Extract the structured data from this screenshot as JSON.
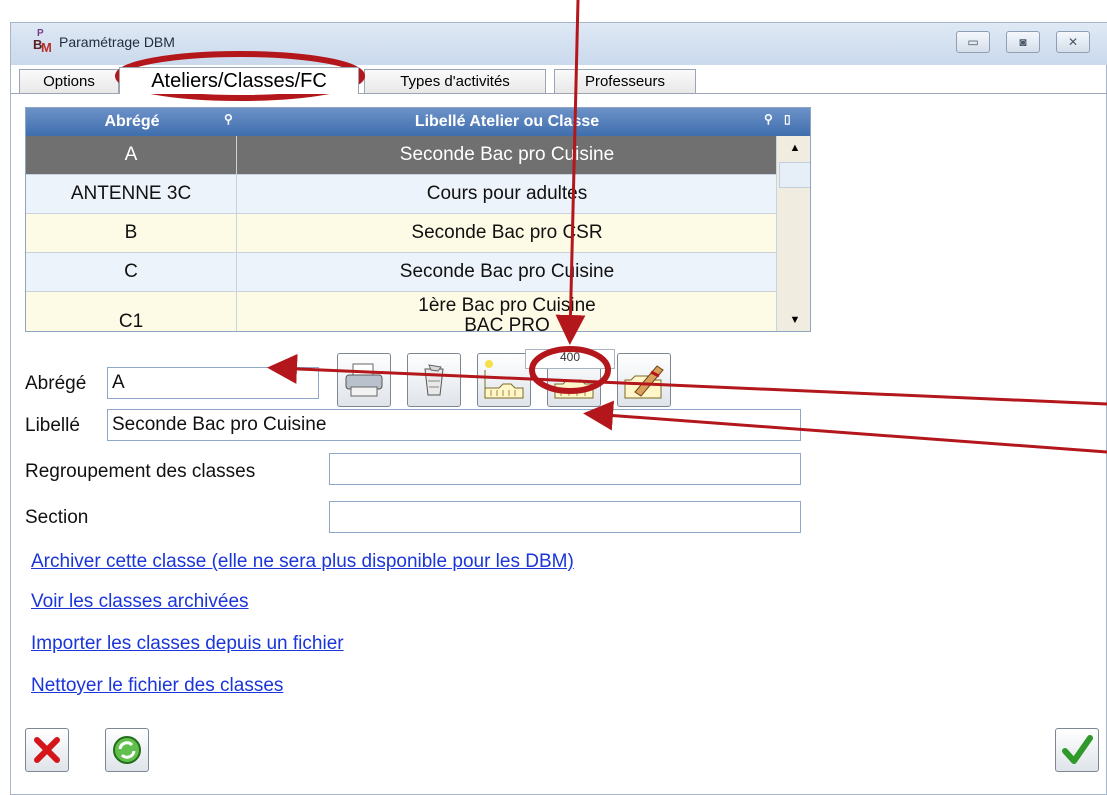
{
  "window": {
    "title": "Paramétrage DBM",
    "icon": "dbm-app-icon",
    "icon_text_top": "P",
    "icon_text_b": "B",
    "icon_text_m": "M",
    "buttons": [
      "minimize",
      "maximize",
      "close"
    ]
  },
  "tabs": [
    {
      "label": "Options",
      "active": false
    },
    {
      "label": "Ateliers/Classes/FC",
      "active": true
    },
    {
      "label": "Types d'activités",
      "active": false
    },
    {
      "label": "Professeurs",
      "active": false
    }
  ],
  "table": {
    "columns": [
      "Abrégé",
      "Libellé Atelier ou Classe"
    ],
    "rows": [
      {
        "abrege": "A",
        "libelle": "Seconde Bac pro Cuisine",
        "selected": true
      },
      {
        "abrege": "ANTENNE 3C",
        "libelle": "Cours pour adultes"
      },
      {
        "abrege": "B",
        "libelle": "Seconde Bac pro CSR"
      },
      {
        "abrege": "C",
        "libelle": "Seconde Bac pro Cuisine"
      },
      {
        "abrege": "C1",
        "libelle": "1ère Bac pro Cuisine",
        "libelle_line2": "BAC PRO"
      }
    ]
  },
  "tooltip": "400",
  "toolbar": [
    {
      "name": "print-icon"
    },
    {
      "name": "delete-icon"
    },
    {
      "name": "new-record-icon"
    },
    {
      "name": "highlighted-record-icon"
    },
    {
      "name": "edit-record-icon"
    }
  ],
  "form": {
    "abrege_label": "Abrégé",
    "abrege_value": "A",
    "libelle_label": "Libellé",
    "libelle_value": "Seconde Bac pro Cuisine",
    "regroupement_label": "Regroupement des classes",
    "regroupement_value": "",
    "section_label": "Section",
    "section_value": ""
  },
  "links": [
    "Archiver cette classe (elle ne sera plus disponible pour les DBM)",
    "Voir les classes archivées",
    "Importer les classes depuis un fichier",
    "Nettoyer le fichier des classes"
  ],
  "bottom_buttons": [
    "cancel-icon",
    "refresh-icon",
    "validate-icon"
  ],
  "colors": {
    "annotation": "#b3171b",
    "header": "#4a77b4",
    "link": "#1a35d9"
  }
}
